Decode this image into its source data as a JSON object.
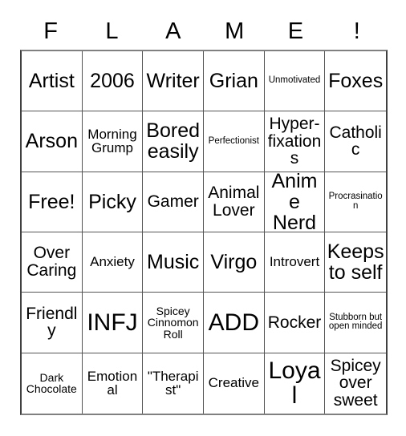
{
  "card": {
    "header_letters": [
      "F",
      "L",
      "A",
      "M",
      "E",
      "!"
    ],
    "columns": 6,
    "rows": 6,
    "free_space_label": "Free!",
    "colors": {
      "background": "#ffffff",
      "text": "#000000",
      "grid_line": "#555555",
      "outer_border": "#404040"
    },
    "cells": [
      {
        "text": "Artist",
        "size": "lg"
      },
      {
        "text": "2006",
        "size": "lg"
      },
      {
        "text": "Writer",
        "size": "lg"
      },
      {
        "text": "Grian",
        "size": "lg"
      },
      {
        "text": "Unmotivated",
        "size": "xxs"
      },
      {
        "text": "Foxes",
        "size": "lg"
      },
      {
        "text": "Arson",
        "size": "lg"
      },
      {
        "text": "Morning Grump",
        "size": "sm"
      },
      {
        "text": "Bored easily",
        "size": "lg"
      },
      {
        "text": "Perfectionist",
        "size": "xxs"
      },
      {
        "text": "Hyper-fixations",
        "size": "md"
      },
      {
        "text": "Catholic",
        "size": "md"
      },
      {
        "text": "Free!",
        "size": "lg"
      },
      {
        "text": "Picky",
        "size": "lg"
      },
      {
        "text": "Gamer",
        "size": "md"
      },
      {
        "text": "Animal Lover",
        "size": "md"
      },
      {
        "text": "Anime Nerd",
        "size": "lg"
      },
      {
        "text": "Procrasination",
        "size": "xxs"
      },
      {
        "text": "Over Caring",
        "size": "md"
      },
      {
        "text": "Anxiety",
        "size": "sm"
      },
      {
        "text": "Music",
        "size": "lg"
      },
      {
        "text": "Virgo",
        "size": "lg"
      },
      {
        "text": "Introvert",
        "size": "sm"
      },
      {
        "text": "Keeps to self",
        "size": "lg"
      },
      {
        "text": "Friendly",
        "size": "md"
      },
      {
        "text": "INFJ",
        "size": "xl"
      },
      {
        "text": "Spicey Cinnomon Roll",
        "size": "xs"
      },
      {
        "text": "ADD",
        "size": "xl"
      },
      {
        "text": "Rocker",
        "size": "md"
      },
      {
        "text": "Stubborn but open minded",
        "size": "xxs"
      },
      {
        "text": "Dark Chocolate",
        "size": "xs"
      },
      {
        "text": "Emotional",
        "size": "sm"
      },
      {
        "text": "\"Therapist\"",
        "size": "sm"
      },
      {
        "text": "Creative",
        "size": "sm"
      },
      {
        "text": "Loyal",
        "size": "xl"
      },
      {
        "text": "Spicey over sweet",
        "size": "md"
      }
    ]
  }
}
